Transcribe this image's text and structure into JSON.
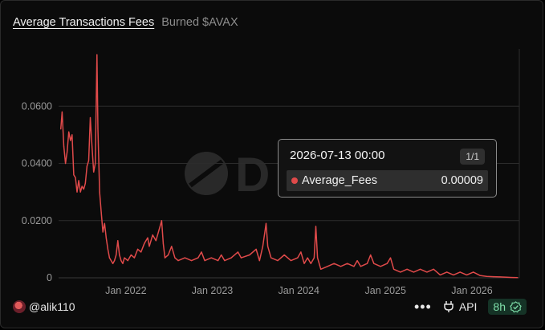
{
  "header": {
    "tab_active": "Average Transactions Fees",
    "tab_inactive": "Burned $AVAX"
  },
  "tooltip": {
    "date": "2026-07-13 00:00",
    "count": "1/1",
    "series_name": "Average_Fees",
    "value": "0.00009"
  },
  "footer": {
    "username": "@alik110",
    "more_label": "•••",
    "api_label": "API",
    "refresh_label": "8h"
  },
  "colors": {
    "line": "#e04a4a",
    "badge_bg": "#153326",
    "badge_text": "#7fe0aa"
  },
  "icons": [
    "avatar",
    "more-icon",
    "api-plug-icon",
    "check-badge-icon"
  ],
  "chart_data": {
    "type": "line",
    "series": [
      {
        "name": "Average_Fees",
        "points": [
          [
            "2021-04-01",
            0.052
          ],
          [
            "2021-04-07",
            0.058
          ],
          [
            "2021-04-14",
            0.046
          ],
          [
            "2021-04-21",
            0.04
          ],
          [
            "2021-04-28",
            0.044
          ],
          [
            "2021-05-05",
            0.051
          ],
          [
            "2021-05-12",
            0.048
          ],
          [
            "2021-05-19",
            0.05
          ],
          [
            "2021-05-26",
            0.036
          ],
          [
            "2021-06-02",
            0.035
          ],
          [
            "2021-06-09",
            0.03
          ],
          [
            "2021-06-16",
            0.034
          ],
          [
            "2021-06-23",
            0.03
          ],
          [
            "2021-06-30",
            0.032
          ],
          [
            "2021-07-07",
            0.031
          ],
          [
            "2021-07-14",
            0.033
          ],
          [
            "2021-07-21",
            0.039
          ],
          [
            "2021-07-28",
            0.041
          ],
          [
            "2021-08-04",
            0.056
          ],
          [
            "2021-08-11",
            0.046
          ],
          [
            "2021-08-18",
            0.037
          ],
          [
            "2021-08-25",
            0.04
          ],
          [
            "2021-09-01",
            0.078
          ],
          [
            "2021-09-05",
            0.052
          ],
          [
            "2021-09-12",
            0.03
          ],
          [
            "2021-09-19",
            0.023
          ],
          [
            "2021-09-26",
            0.016
          ],
          [
            "2021-10-03",
            0.019
          ],
          [
            "2021-10-10",
            0.014
          ],
          [
            "2021-10-17",
            0.01
          ],
          [
            "2021-10-24",
            0.007
          ],
          [
            "2021-10-31",
            0.006
          ],
          [
            "2021-11-07",
            0.005
          ],
          [
            "2021-11-14",
            0.006
          ],
          [
            "2021-11-21",
            0.008
          ],
          [
            "2021-11-28",
            0.013
          ],
          [
            "2021-12-05",
            0.008
          ],
          [
            "2021-12-12",
            0.006
          ],
          [
            "2021-12-19",
            0.005
          ],
          [
            "2021-12-26",
            0.007
          ],
          [
            "2022-01-09",
            0.006
          ],
          [
            "2022-01-23",
            0.008
          ],
          [
            "2022-02-06",
            0.007
          ],
          [
            "2022-02-20",
            0.01
          ],
          [
            "2022-03-06",
            0.009
          ],
          [
            "2022-03-20",
            0.012
          ],
          [
            "2022-04-03",
            0.014
          ],
          [
            "2022-04-10",
            0.011
          ],
          [
            "2022-04-24",
            0.015
          ],
          [
            "2022-05-08",
            0.013
          ],
          [
            "2022-05-22",
            0.017
          ],
          [
            "2022-06-01",
            0.02
          ],
          [
            "2022-06-08",
            0.012
          ],
          [
            "2022-06-15",
            0.007
          ],
          [
            "2022-06-29",
            0.008
          ],
          [
            "2022-07-13",
            0.011
          ],
          [
            "2022-07-27",
            0.007
          ],
          [
            "2022-08-10",
            0.006
          ],
          [
            "2022-09-07",
            0.007
          ],
          [
            "2022-10-05",
            0.006
          ],
          [
            "2022-11-02",
            0.007
          ],
          [
            "2022-11-16",
            0.009
          ],
          [
            "2022-11-30",
            0.006
          ],
          [
            "2022-12-28",
            0.007
          ],
          [
            "2023-01-25",
            0.006
          ],
          [
            "2023-02-08",
            0.008
          ],
          [
            "2023-02-22",
            0.006
          ],
          [
            "2023-03-22",
            0.007
          ],
          [
            "2023-04-19",
            0.009
          ],
          [
            "2023-05-03",
            0.007
          ],
          [
            "2023-06-07",
            0.008
          ],
          [
            "2023-07-05",
            0.01
          ],
          [
            "2023-07-19",
            0.006
          ],
          [
            "2023-08-02",
            0.011
          ],
          [
            "2023-08-16",
            0.019
          ],
          [
            "2023-08-23",
            0.011
          ],
          [
            "2023-09-06",
            0.007
          ],
          [
            "2023-10-04",
            0.006
          ],
          [
            "2023-11-01",
            0.008
          ],
          [
            "2023-11-29",
            0.006
          ],
          [
            "2023-12-27",
            0.007
          ],
          [
            "2024-01-10",
            0.009
          ],
          [
            "2024-01-24",
            0.005
          ],
          [
            "2024-02-07",
            0.007
          ],
          [
            "2024-02-21",
            0.005
          ],
          [
            "2024-03-06",
            0.007
          ],
          [
            "2024-03-13",
            0.018
          ],
          [
            "2024-03-20",
            0.007
          ],
          [
            "2024-04-03",
            0.003
          ],
          [
            "2024-05-01",
            0.004
          ],
          [
            "2024-05-29",
            0.005
          ],
          [
            "2024-06-26",
            0.004
          ],
          [
            "2024-07-24",
            0.005
          ],
          [
            "2024-08-21",
            0.004
          ],
          [
            "2024-09-04",
            0.006
          ],
          [
            "2024-09-18",
            0.004
          ],
          [
            "2024-10-16",
            0.005
          ],
          [
            "2024-10-30",
            0.008
          ],
          [
            "2024-11-13",
            0.005
          ],
          [
            "2024-12-11",
            0.004
          ],
          [
            "2025-01-08",
            0.005
          ],
          [
            "2025-01-22",
            0.007
          ],
          [
            "2025-02-05",
            0.003
          ],
          [
            "2025-03-05",
            0.002
          ],
          [
            "2025-04-02",
            0.003
          ],
          [
            "2025-04-30",
            0.002
          ],
          [
            "2025-05-28",
            0.003
          ],
          [
            "2025-06-25",
            0.002
          ],
          [
            "2025-07-23",
            0.003
          ],
          [
            "2025-08-20",
            0.001
          ],
          [
            "2025-09-17",
            0.002
          ],
          [
            "2025-10-15",
            0.001
          ],
          [
            "2025-11-12",
            0.002
          ],
          [
            "2025-12-10",
            0.001
          ],
          [
            "2026-01-07",
            0.002
          ],
          [
            "2026-02-04",
            0.0008
          ],
          [
            "2026-03-04",
            0.0005
          ],
          [
            "2026-04-01",
            0.0004
          ],
          [
            "2026-04-29",
            0.0003
          ],
          [
            "2026-05-27",
            0.0002
          ],
          [
            "2026-06-24",
            0.0001
          ],
          [
            "2026-07-13",
            9e-05
          ]
        ]
      }
    ],
    "x_ticks": [
      "Jan 2022",
      "Jan 2023",
      "Jan 2024",
      "Jan 2025",
      "Jan 2026"
    ],
    "y_ticks": [
      "0",
      "0.0200",
      "0.0400",
      "0.0600"
    ],
    "ylim": [
      0,
      0.08
    ],
    "xlim": [
      "2021-03-23",
      "2026-07-20"
    ],
    "grid": "horizontal"
  }
}
